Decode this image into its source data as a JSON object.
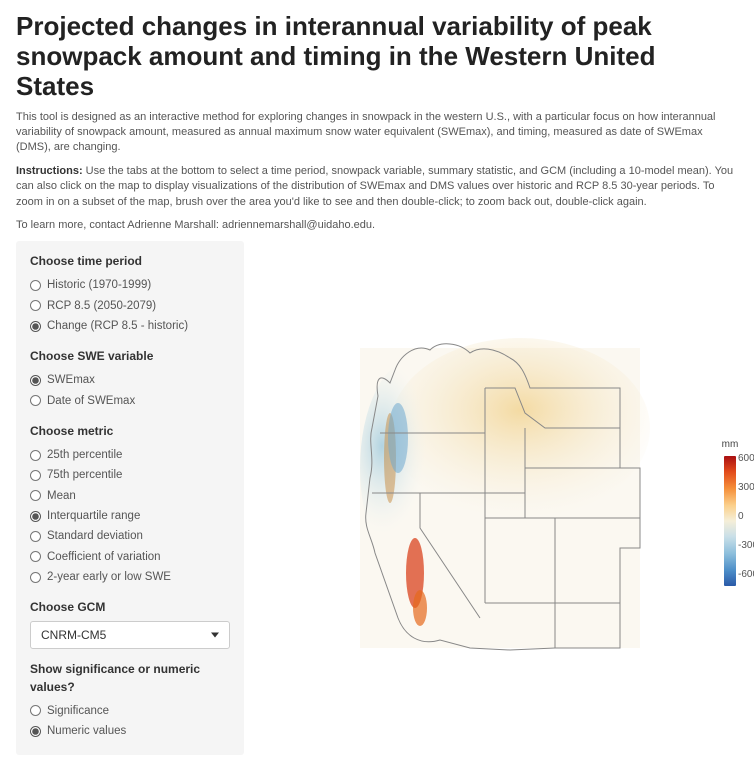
{
  "title": "Projected changes in interannual variability of peak snowpack amount and timing in the Western United States",
  "intro": {
    "p1": "This tool is designed as an interactive method for exploring changes in snowpack in the western U.S., with a particular focus on how interannual variability of snowpack amount, measured as annual maximum snow water equivalent (SWEmax), and timing, measured as date of SWEmax (DMS), are changing.",
    "instr_label": "Instructions:",
    "p2": " Use the tabs at the bottom to select a time period, snowpack variable, summary statistic, and GCM (including a 10-model mean). You can also click on the map to display visualizations of the distribution of SWEmax and DMS values over historic and RCP 8.5 30-year periods. To zoom in on a subset of the map, brush over the area you'd like to see and then double-click; to zoom back out, double-click again.",
    "p3": "To learn more, contact Adrienne Marshall: adriennemarshall@uidaho.edu."
  },
  "sidebar": {
    "time_period": {
      "label": "Choose time period",
      "options": [
        "Historic (1970-1999)",
        "RCP 8.5 (2050-2079)",
        "Change (RCP 8.5 - historic)"
      ],
      "selected_index": 2
    },
    "swe_var": {
      "label": "Choose SWE variable",
      "options": [
        "SWEmax",
        "Date of SWEmax"
      ],
      "selected_index": 0
    },
    "metric": {
      "label": "Choose metric",
      "options": [
        "25th percentile",
        "75th percentile",
        "Mean",
        "Interquartile range",
        "Standard deviation",
        "Coefficient of variation",
        "2-year early or low SWE"
      ],
      "selected_index": 3
    },
    "gcm": {
      "label": "Choose GCM",
      "selected": "CNRM-CM5"
    },
    "sig": {
      "label": "Show significance or numeric values?",
      "options": [
        "Significance",
        "Numeric values"
      ],
      "selected_index": 1
    }
  },
  "legend": {
    "unit": "mm",
    "ticks": [
      "600",
      "300",
      "0",
      "-300",
      "-600"
    ]
  }
}
